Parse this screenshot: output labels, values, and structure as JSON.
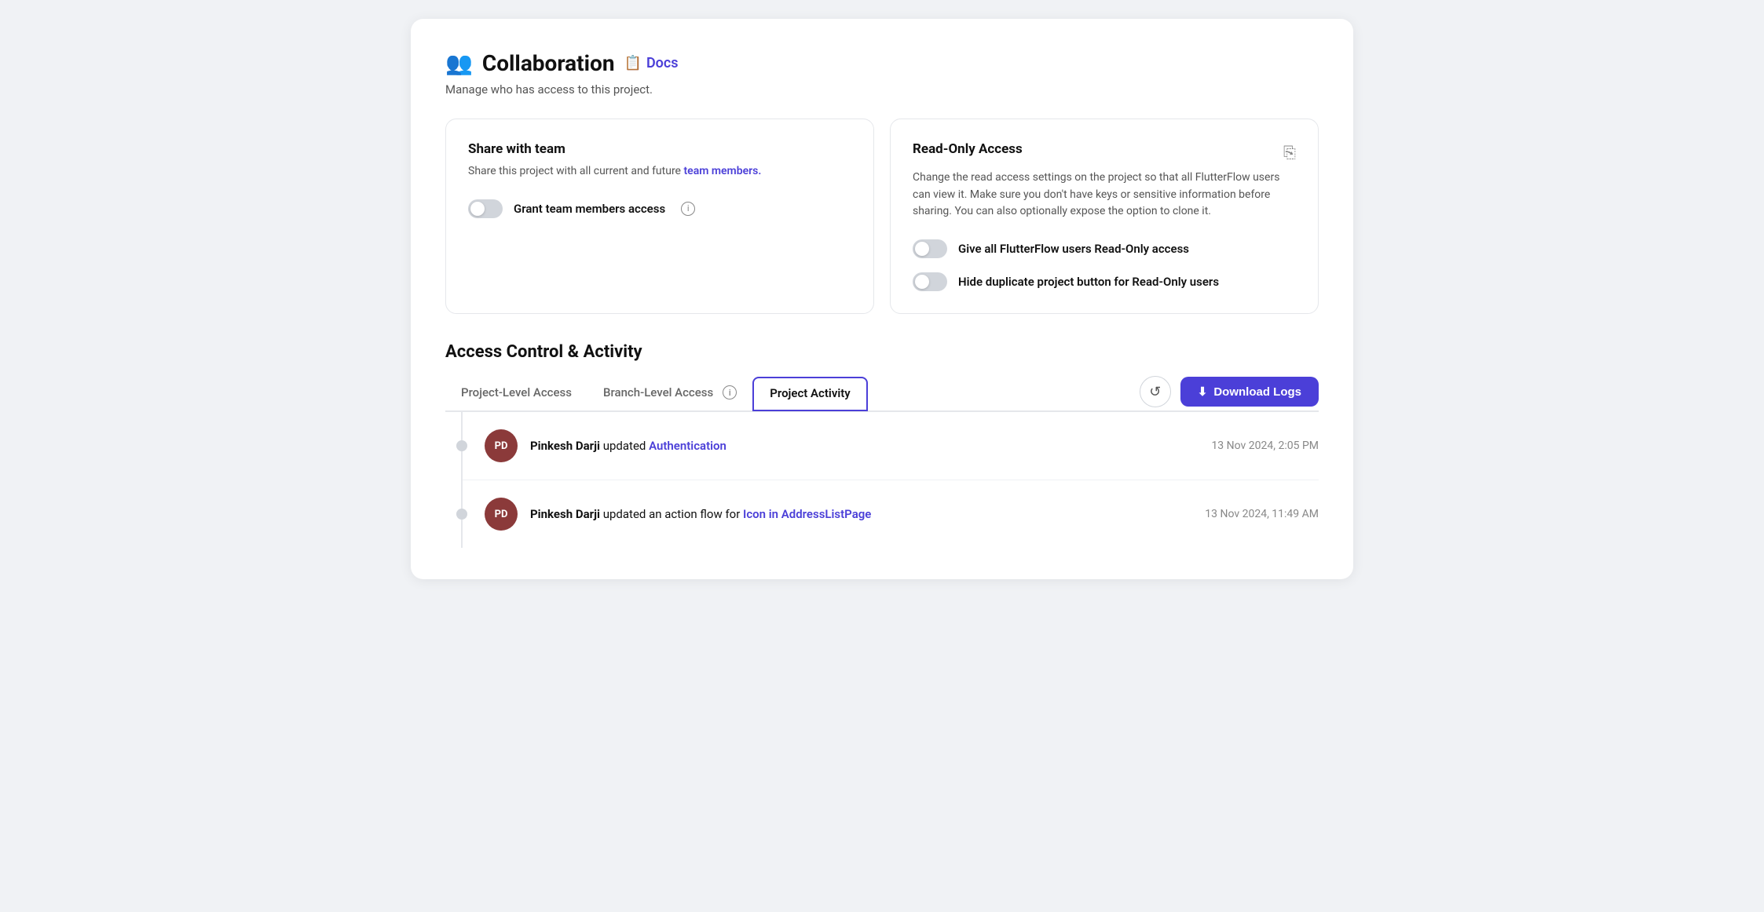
{
  "page": {
    "title": "Collaboration",
    "subtitle": "Manage who has access to this project.",
    "docs_label": "Docs"
  },
  "share_card": {
    "title": "Share with team",
    "description_prefix": "Share this project with all current and future ",
    "team_members_link": "team members.",
    "toggle_label": "Grant team members access",
    "toggle_state": false
  },
  "readonly_card": {
    "title": "Read-Only Access",
    "description": "Change the read access settings on the project so that all FlutterFlow users can view it. Make sure you don't have keys or sensitive information before sharing. You can also optionally expose the option to clone it.",
    "toggle1_label": "Give all FlutterFlow users Read-Only access",
    "toggle1_state": false,
    "toggle2_label": "Hide duplicate project button for Read-Only users",
    "toggle2_state": false
  },
  "access_section": {
    "title": "Access Control & Activity"
  },
  "tabs": [
    {
      "id": "project-level-access",
      "label": "Project-Level Access",
      "active": false
    },
    {
      "id": "branch-level-access",
      "label": "Branch-Level Access",
      "active": false,
      "has_info": true
    },
    {
      "id": "project-activity",
      "label": "Project Activity",
      "active": true
    }
  ],
  "actions": {
    "refresh_icon": "↺",
    "download_label": "Download Logs",
    "download_icon": "⬇"
  },
  "activity_items": [
    {
      "avatar_initials": "PD",
      "user_name": "Pinkesh Darji",
      "action": "updated",
      "link_text": "Authentication",
      "timestamp": "13 Nov 2024, 2:05 PM"
    },
    {
      "avatar_initials": "PD",
      "user_name": "Pinkesh Darji",
      "action": "updated an action flow for",
      "link_text": "Icon in AddressListPage",
      "timestamp": "13 Nov 2024, 11:49 AM"
    }
  ],
  "colors": {
    "accent": "#4b3fd8",
    "avatar_bg": "#8b3a3a"
  }
}
